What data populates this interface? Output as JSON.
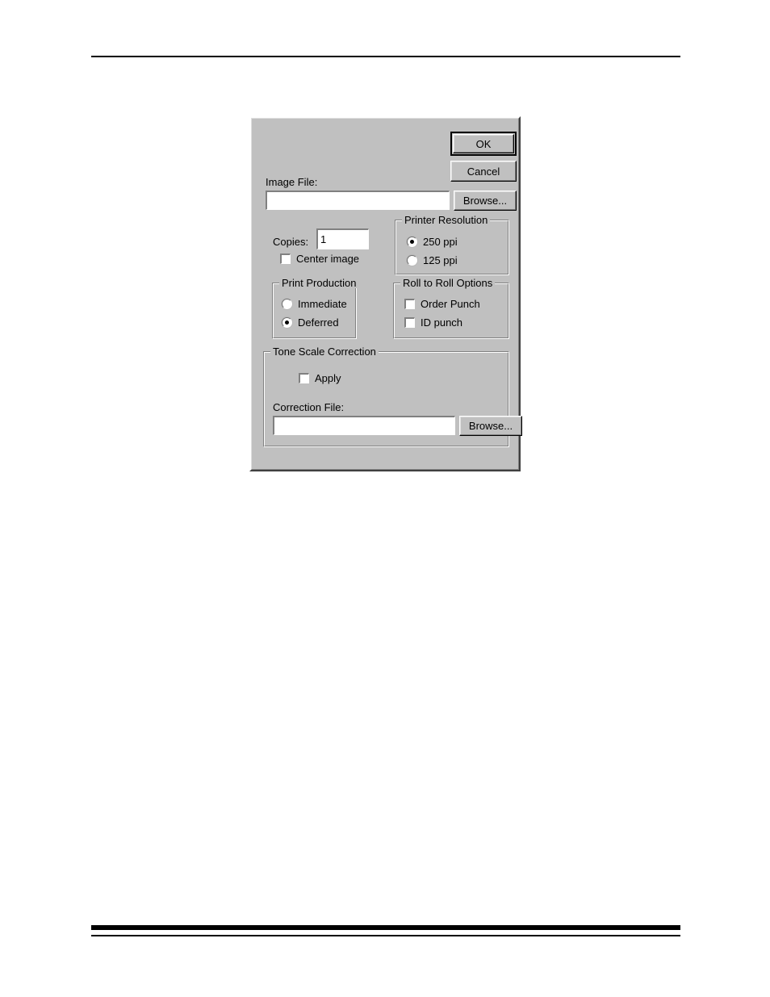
{
  "page": {
    "background_color": "#ffffff",
    "rules": {
      "top_rule": "",
      "bottom_thick_rule": "",
      "bottom_thin_rule": ""
    }
  },
  "dialog": {
    "background_color": "#c0c0c0",
    "buttons": {
      "ok_label": "OK",
      "cancel_label": "Cancel",
      "browse_image_label": "Browse...",
      "browse_correction_label": "Browse..."
    },
    "image_file": {
      "label": "Image File:",
      "value": "",
      "placeholder": ""
    },
    "copies": {
      "label": "Copies:",
      "value": "1"
    },
    "center_image": {
      "label": "Center image",
      "checked": false
    },
    "printer_resolution": {
      "title": "Printer Resolution",
      "options": [
        {
          "label": "250 ppi",
          "selected": true
        },
        {
          "label": "125 ppi",
          "selected": false
        }
      ]
    },
    "print_production": {
      "title": "Print Production",
      "options": [
        {
          "label": "Immediate",
          "selected": false
        },
        {
          "label": "Deferred",
          "selected": true
        }
      ]
    },
    "roll_to_roll": {
      "title": "Roll to Roll Options",
      "options": [
        {
          "label": "Order Punch",
          "checked": false
        },
        {
          "label": "ID punch",
          "checked": false
        }
      ]
    },
    "tone_scale_correction": {
      "title": "Tone Scale Correction",
      "apply": {
        "label": "Apply",
        "checked": false
      },
      "correction_file": {
        "label": "Correction File:",
        "value": "",
        "placeholder": ""
      }
    }
  }
}
